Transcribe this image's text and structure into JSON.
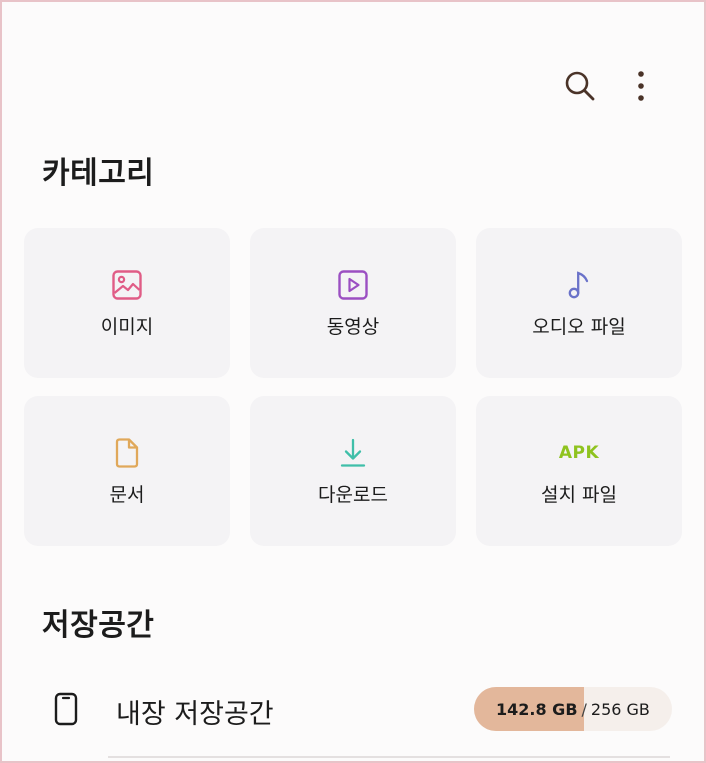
{
  "header": {
    "search_icon": "search-icon",
    "more_icon": "more-vertical-icon"
  },
  "categories": {
    "title": "카테고리",
    "items": [
      {
        "label": "이미지",
        "icon": "image-icon",
        "color": "#e05c86"
      },
      {
        "label": "동영상",
        "icon": "play-icon",
        "color": "#9b4fc2"
      },
      {
        "label": "오디오 파일",
        "icon": "music-note-icon",
        "color": "#6a72c9"
      },
      {
        "label": "문서",
        "icon": "document-icon",
        "color": "#e0a85a"
      },
      {
        "label": "다운로드",
        "icon": "download-icon",
        "color": "#3fbfa9"
      },
      {
        "label": "설치 파일",
        "icon": "apk-icon",
        "icon_text": "APK",
        "color": "#8fc31f"
      }
    ]
  },
  "storage": {
    "title": "저장공간",
    "items": [
      {
        "label": "내장 저장공간",
        "icon": "phone-icon",
        "used": "142.8 GB",
        "separator": "/",
        "total": "256 GB",
        "used_fraction": 0.558
      }
    ]
  }
}
